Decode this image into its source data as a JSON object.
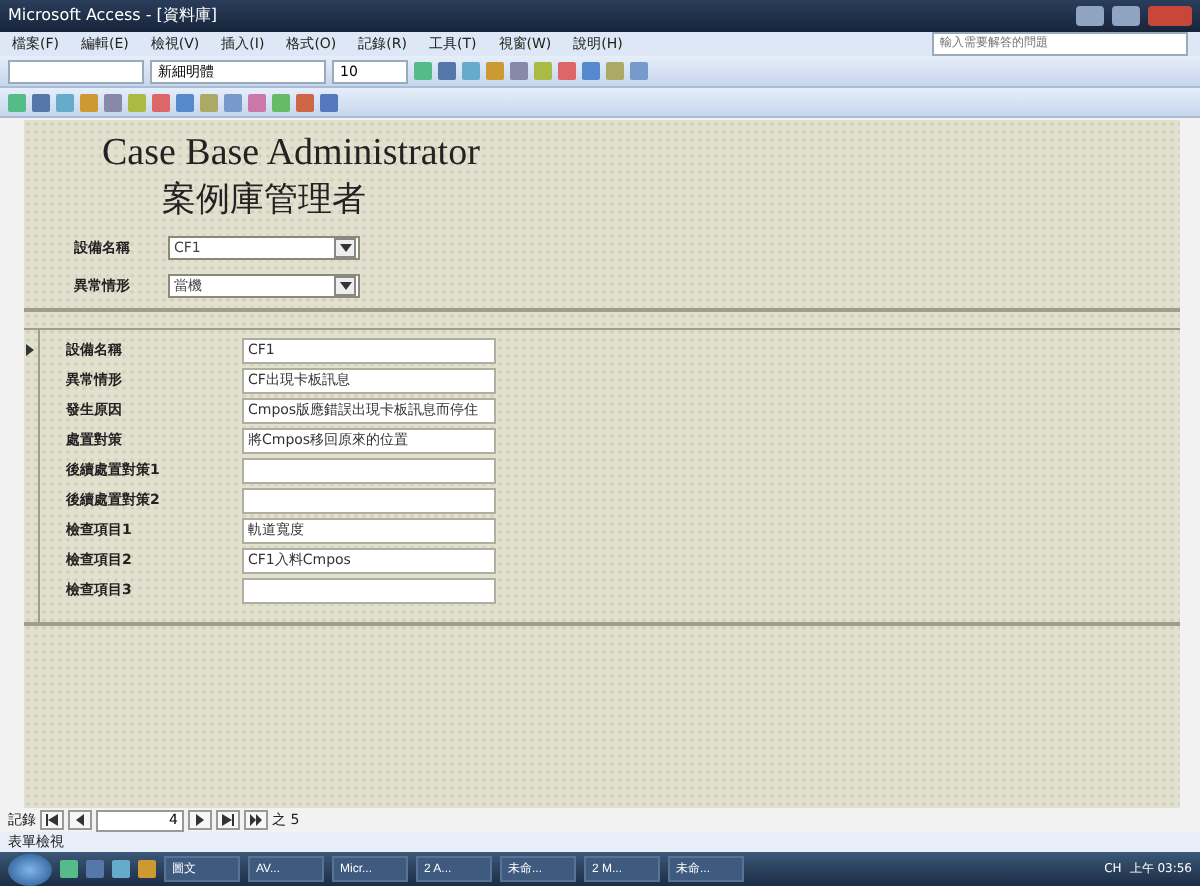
{
  "window": {
    "title": "Microsoft Access - [資料庫]"
  },
  "menu": [
    "檔案(F)",
    "編輯(E)",
    "檢視(V)",
    "插入(I)",
    "格式(O)",
    "記錄(R)",
    "工具(T)",
    "視窗(W)",
    "說明(H)"
  ],
  "help_box": {
    "placeholder": "輸入需要解答的問題"
  },
  "format_toolbar": {
    "font": "新細明體",
    "size": "10"
  },
  "form": {
    "title": "Case Base Administrator",
    "subtitle": "案例庫管理者",
    "filters": [
      {
        "label": "設備名稱",
        "value": "CF1"
      },
      {
        "label": "異常情形",
        "value": "當機"
      }
    ],
    "fields": [
      {
        "label": "設備名稱",
        "value": "CF1"
      },
      {
        "label": "異常情形",
        "value": "CF出現卡板訊息"
      },
      {
        "label": "發生原因",
        "value": "Cmpos版應錯誤出現卡板訊息而停住"
      },
      {
        "label": "處置對策",
        "value": "將Cmpos移回原來的位置"
      },
      {
        "label": "後續處置對策1"
      },
      {
        "label": "後續處置對策2"
      },
      {
        "label": "檢查項目1",
        "value": "軌道寬度"
      },
      {
        "label": "檢查項目2",
        "value": "CF1入料Cmpos"
      },
      {
        "label": "檢查項目3"
      }
    ]
  },
  "navigator": {
    "label": "記錄",
    "current": "4",
    "total": "之 5"
  },
  "status_bar": "表單檢視",
  "taskbar": {
    "items": [
      "圖文",
      "AV...",
      "Micr...",
      "2 A...",
      "未命...",
      "2 M...",
      "未命..."
    ],
    "language": "CH",
    "clock": "上午 03:56"
  }
}
